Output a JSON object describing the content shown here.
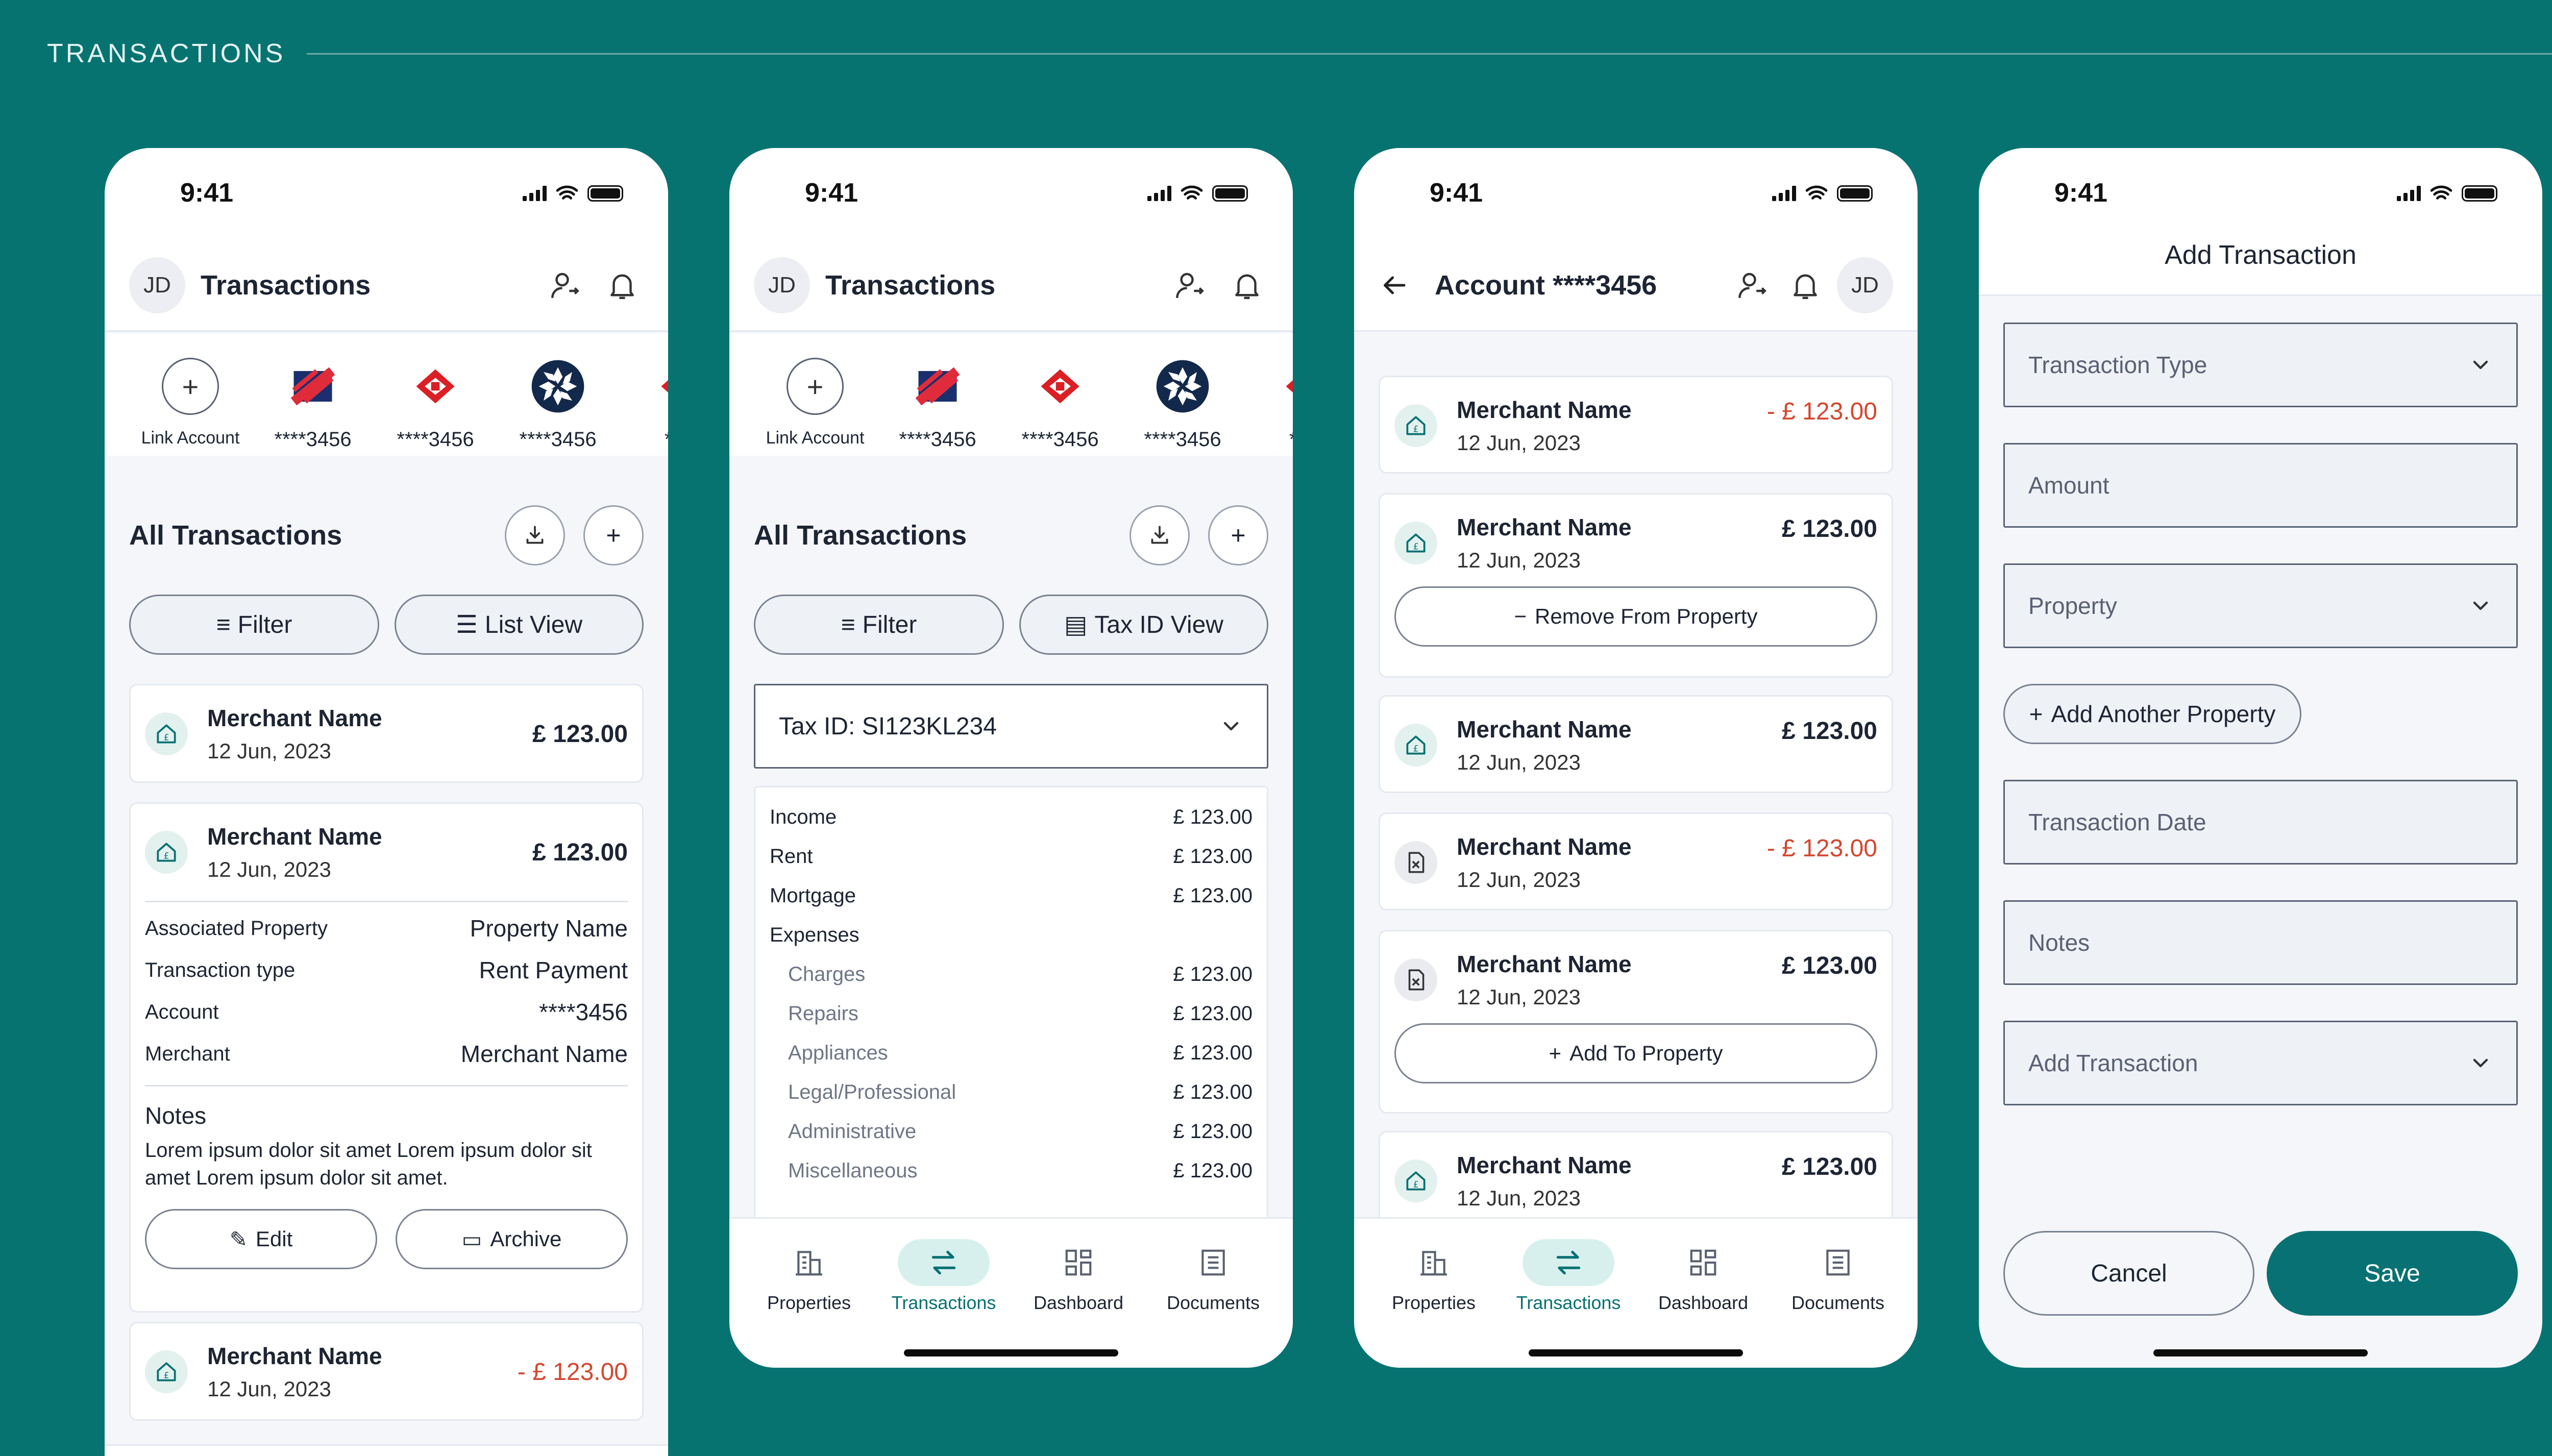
{
  "section_title": "TRANSACTIONS",
  "status": {
    "time": "9:41"
  },
  "colors": {
    "background": "#067371",
    "accent": "#087173",
    "negative": "#d5462e"
  },
  "screen1": {
    "avatar": "JD",
    "title": "Transactions",
    "accounts": [
      {
        "label": "Link Account",
        "icon": "plus-icon"
      },
      {
        "label": "****3456",
        "icon": "bank-logo-red-blue"
      },
      {
        "label": "****3456",
        "icon": "bank-logo-hexagon-red"
      },
      {
        "label": "****3456",
        "icon": "bank-logo-navy-star"
      },
      {
        "label": "****",
        "icon": "bank-logo-partial"
      }
    ],
    "section": "All Transactions",
    "filter_label": "Filter",
    "view_label": "List View",
    "tx": [
      {
        "merchant": "Merchant Name",
        "date": "12 Jun, 2023",
        "amount": "£ 123.00"
      },
      {
        "merchant": "Merchant Name",
        "date": "12 Jun, 2023",
        "amount": "£ 123.00"
      },
      {
        "merchant": "Merchant Name",
        "date": "12 Jun, 2023",
        "amount": "- £ 123.00"
      }
    ],
    "details": [
      {
        "k": "Associated Property",
        "v": "Property Name"
      },
      {
        "k": "Transaction type",
        "v": "Rent Payment"
      },
      {
        "k": "Account",
        "v": "****3456"
      },
      {
        "k": "Merchant",
        "v": "Merchant Name"
      }
    ],
    "notes_title": "Notes",
    "notes_text": "Lorem ipsum dolor sit amet Lorem ipsum dolor sit amet Lorem ipsum dolor sit amet.",
    "edit_label": "Edit",
    "archive_label": "Archive"
  },
  "screen2": {
    "avatar": "JD",
    "title": "Transactions",
    "section": "All Transactions",
    "filter_label": "Filter",
    "view_label": "Tax ID View",
    "tax_id": "Tax ID: SI123KL234",
    "rows": [
      {
        "label": "Income",
        "value": "£ 123.00"
      },
      {
        "label": "Rent",
        "value": "£ 123.00"
      },
      {
        "label": "Mortgage",
        "value": "£ 123.00"
      },
      {
        "label": "Expenses",
        "value": ""
      },
      {
        "label": "Charges",
        "value": "£ 123.00"
      },
      {
        "label": "Repairs",
        "value": "£ 123.00"
      },
      {
        "label": "Appliances",
        "value": "£ 123.00"
      },
      {
        "label": "Legal/Professional",
        "value": "£ 123.00"
      },
      {
        "label": "Administrative",
        "value": "£ 123.00"
      },
      {
        "label": "Miscellaneous",
        "value": "£ 123.00"
      }
    ]
  },
  "screen3": {
    "title": "Account ****3456",
    "avatar": "JD",
    "tx": [
      {
        "merchant": "Merchant Name",
        "date": "12 Jun, 2023",
        "amount": "- £ 123.00"
      },
      {
        "merchant": "Merchant Name",
        "date": "12 Jun, 2023",
        "amount": "£ 123.00"
      },
      {
        "merchant": "Merchant Name",
        "date": "12 Jun, 2023",
        "amount": "£ 123.00"
      },
      {
        "merchant": "Merchant Name",
        "date": "12 Jun, 2023",
        "amount": "- £ 123.00"
      },
      {
        "merchant": "Merchant Name",
        "date": "12 Jun, 2023",
        "amount": "£ 123.00"
      },
      {
        "merchant": "Merchant Name",
        "date": "12 Jun, 2023",
        "amount": "£ 123.00"
      }
    ],
    "remove_label": "Remove From Property",
    "add_label": "Add To Property"
  },
  "nav": [
    {
      "label": "Properties",
      "icon": "building-icon"
    },
    {
      "label": "Transactions",
      "icon": "arrows-icon"
    },
    {
      "label": "Dashboard",
      "icon": "grid-icon"
    },
    {
      "label": "Documents",
      "icon": "document-icon"
    }
  ],
  "screen4": {
    "title": "Add Transaction",
    "fields": {
      "type": "Transaction Type",
      "amount": "Amount",
      "property": "Property",
      "add_property": "Add Another Property",
      "date": "Transaction Date",
      "notes": "Notes",
      "add_tx": "Add Transaction"
    },
    "cancel_label": "Cancel",
    "save_label": "Save"
  }
}
